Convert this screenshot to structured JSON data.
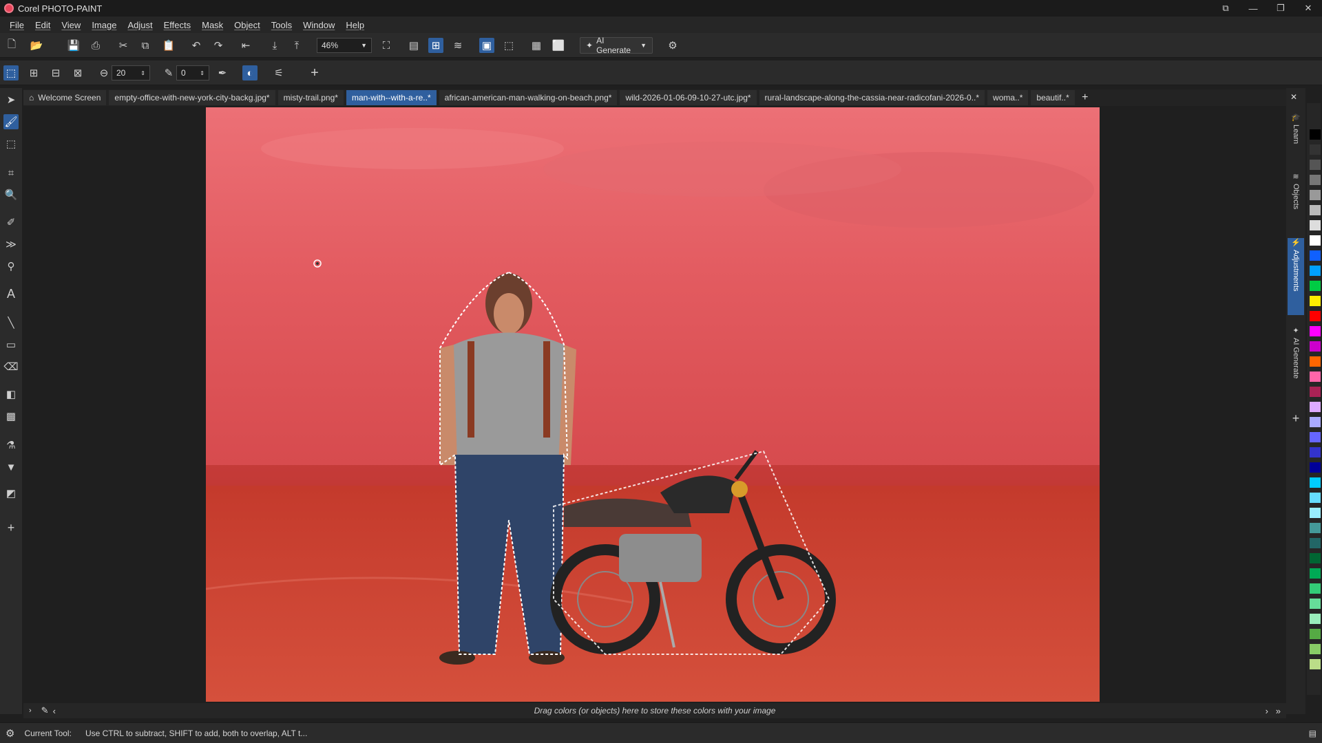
{
  "app": {
    "title": "Corel PHOTO-PAINT"
  },
  "menu": [
    "File",
    "Edit",
    "View",
    "Image",
    "Adjust",
    "Effects",
    "Mask",
    "Object",
    "Tools",
    "Window",
    "Help"
  ],
  "toolbar": {
    "zoom_value": "46%",
    "ai_generate_label": "AI Generate"
  },
  "property_bar": {
    "brush_size": "20",
    "transparency": "0"
  },
  "tabs": [
    {
      "label": "Welcome Screen",
      "active": false
    },
    {
      "label": "empty-office-with-new-york-city-backg.jpg*",
      "active": false
    },
    {
      "label": "misty-trail.png*",
      "active": false
    },
    {
      "label": "man-with--with-a-re..*",
      "active": true
    },
    {
      "label": "african-american-man-walking-on-beach.png*",
      "active": false
    },
    {
      "label": "wild-2026-01-06-09-10-27-utc.jpg*",
      "active": false
    },
    {
      "label": "rural-landscape-along-the-cassia-near-radicofani-2026-0..*",
      "active": false
    },
    {
      "label": "woma..*",
      "active": false
    },
    {
      "label": "beautif..*",
      "active": false
    }
  ],
  "docker_tabs": [
    "Learn",
    "Objects",
    "Adjustments",
    "AI Generate"
  ],
  "color_tray_hint": "Drag colors (or objects) here to store these colors with your image",
  "status": {
    "label": "Current Tool:",
    "hint": "Use CTRL to subtract, SHIFT to add, both to overlap, ALT t..."
  },
  "palette_colors": [
    "#000000",
    "#333333",
    "#555555",
    "#777777",
    "#999999",
    "#bbbbbb",
    "#dddddd",
    "#ffffff",
    "#1060ff",
    "#00a0ff",
    "#00cc44",
    "#ffee00",
    "#ff0000",
    "#ff00ff",
    "#cc00cc",
    "#ff6600",
    "#ff66aa",
    "#aa2255",
    "#ddaaff",
    "#aaaaff",
    "#6666ff",
    "#3333cc",
    "#000099",
    "#00ccff",
    "#66ddff",
    "#99eeff",
    "#449999",
    "#226666",
    "#006633",
    "#00aa55",
    "#33cc77",
    "#66dd99",
    "#99eebb",
    "#55aa44",
    "#88cc66",
    "#bbdd88"
  ]
}
